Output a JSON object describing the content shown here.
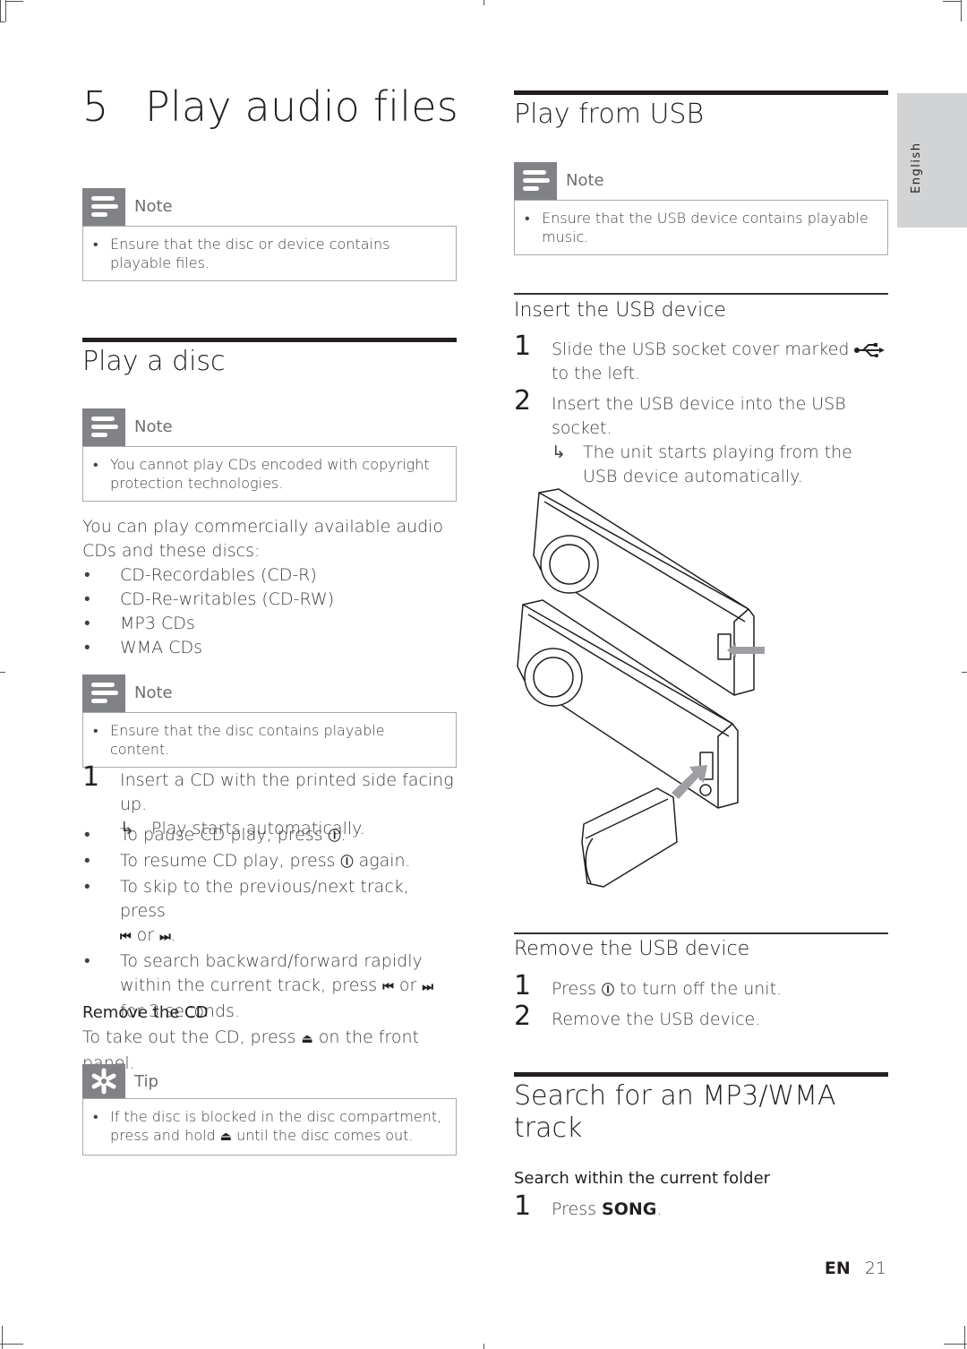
{
  "chapter": {
    "number": "5",
    "title": "Play audio files"
  },
  "language_tab": "English",
  "left": {
    "note1": {
      "label": "Note",
      "text": "Ensure that the disc or device contains playable files."
    },
    "play_disc": {
      "heading": "Play a disc",
      "note": {
        "label": "Note",
        "text": "You cannot play CDs encoded with copyright protection technologies."
      },
      "intro": "You can play commercially available audio CDs and these discs:",
      "disc_types": [
        "CD-Recordables (CD-R)",
        "CD-Re-writables (CD-RW)",
        "MP3 CDs",
        "WMA CDs"
      ],
      "note2": {
        "label": "Note",
        "text": "Ensure that the disc contains playable content."
      },
      "step1": {
        "number": "1",
        "text": "Insert a CD with the printed side facing up.",
        "result": "Play starts automatically."
      },
      "controls": {
        "pause": {
          "pre": "To pause CD play, press ",
          "post": "."
        },
        "resume": {
          "pre": "To resume CD play, press ",
          "post": " again."
        },
        "skip": {
          "pre": "To skip to the previous/next track, press",
          "or": " or ",
          "post": "."
        },
        "search": {
          "pre": "To search backward/forward rapidly within the current track, press ",
          "or": " or ",
          "post": " for 3 seconds."
        }
      },
      "remove_cd": {
        "heading": "Remove the CD",
        "pre": "To take out the CD, press ",
        "post": " on the front panel."
      },
      "tip": {
        "label": "Tip",
        "pre": "If the disc is blocked in the disc compartment, press and hold ",
        "post": " until the disc comes out."
      }
    }
  },
  "right": {
    "play_usb": {
      "heading": "Play from USB",
      "note": {
        "label": "Note",
        "text": "Ensure that the USB device contains playable music."
      },
      "insert": {
        "heading": "Insert the USB device",
        "steps": [
          {
            "number": "1",
            "text": "Slide the USB socket cover marked ",
            "text_after": " to the left."
          },
          {
            "number": "2",
            "text": "Insert the USB device into the USB socket.",
            "result": "The unit starts playing from the USB device automatically."
          }
        ]
      },
      "remove": {
        "heading": "Remove the USB device",
        "steps": [
          {
            "number": "1",
            "pre": "Press ",
            "post": " to turn off the unit."
          },
          {
            "number": "2",
            "text": "Remove the USB device."
          }
        ]
      }
    },
    "search": {
      "heading_line1": "Search for an MP3/WMA",
      "heading_line2": "track",
      "subheading": "Search within the current folder",
      "step1": {
        "number": "1",
        "pre": "Press ",
        "key": "SONG",
        "post": "."
      }
    }
  },
  "symbols": {
    "bullet": "•",
    "arrow": "↳",
    "power": "Ⓘ",
    "prev": "⏮",
    "next": "⏭",
    "eject": "⏏",
    "usb": "⭠"
  },
  "footer": {
    "lang": "EN",
    "page": "21"
  }
}
